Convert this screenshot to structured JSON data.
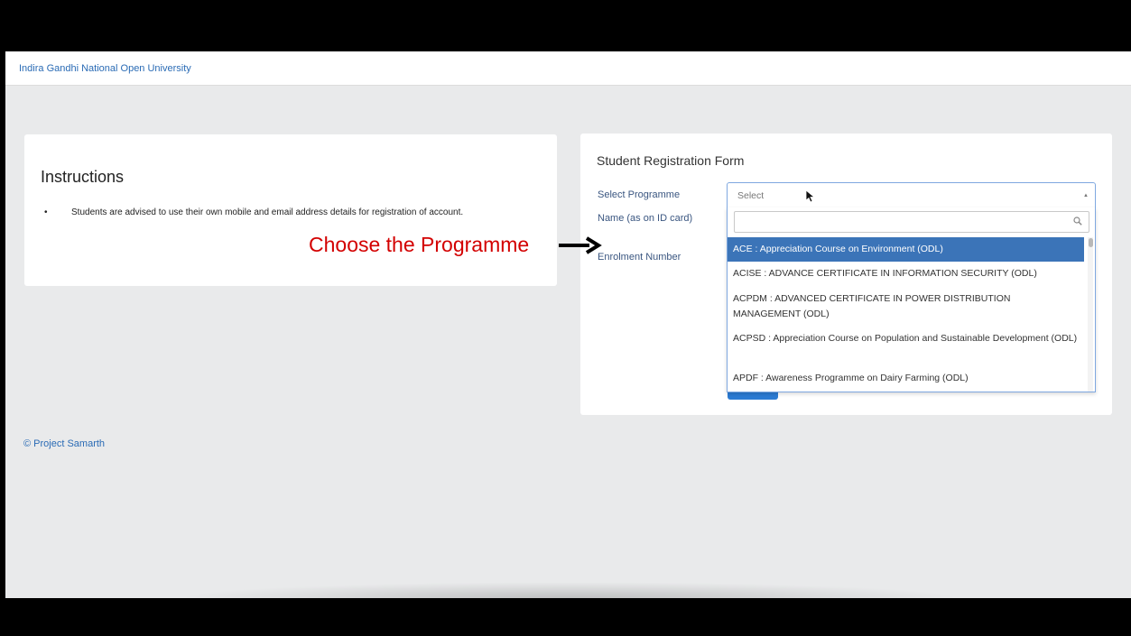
{
  "navbar": {
    "brand": "Indira Gandhi National Open University"
  },
  "instructions": {
    "title": "Instructions",
    "items": [
      "Students are advised to use their own mobile and email address details for registration of account."
    ]
  },
  "form": {
    "title": "Student Registration Form",
    "labels": {
      "programme": "Select Programme",
      "name": "Name (as on ID card)",
      "enrolment": "Enrolment Number"
    },
    "select": {
      "placeholder": "Select",
      "search_value": "",
      "options": [
        "ACE : Appreciation Course on Environment (ODL)",
        "ACISE : ADVANCE CERTIFICATE IN INFORMATION SECURITY (ODL)",
        "ACPDM : ADVANCED CERTIFICATE IN POWER DISTRIBUTION MANAGEMENT (ODL)",
        "ACPSD : Appreciation Course on Population and Sustainable Development (ODL)",
        "APDF : Awareness Programme on Dairy Farming (ODL)"
      ],
      "highlighted_index": 0
    }
  },
  "annotation": {
    "text": "Choose the Programme"
  },
  "footer": {
    "text": "© Project Samarth"
  },
  "colors": {
    "link": "#2a6bb5",
    "highlight": "#3b74b8",
    "annotation": "#d30000"
  },
  "icons": {
    "search": "search-icon",
    "caret": "caret-up-icon",
    "cursor": "mouse-pointer-icon",
    "arrow": "arrow-right-icon"
  }
}
